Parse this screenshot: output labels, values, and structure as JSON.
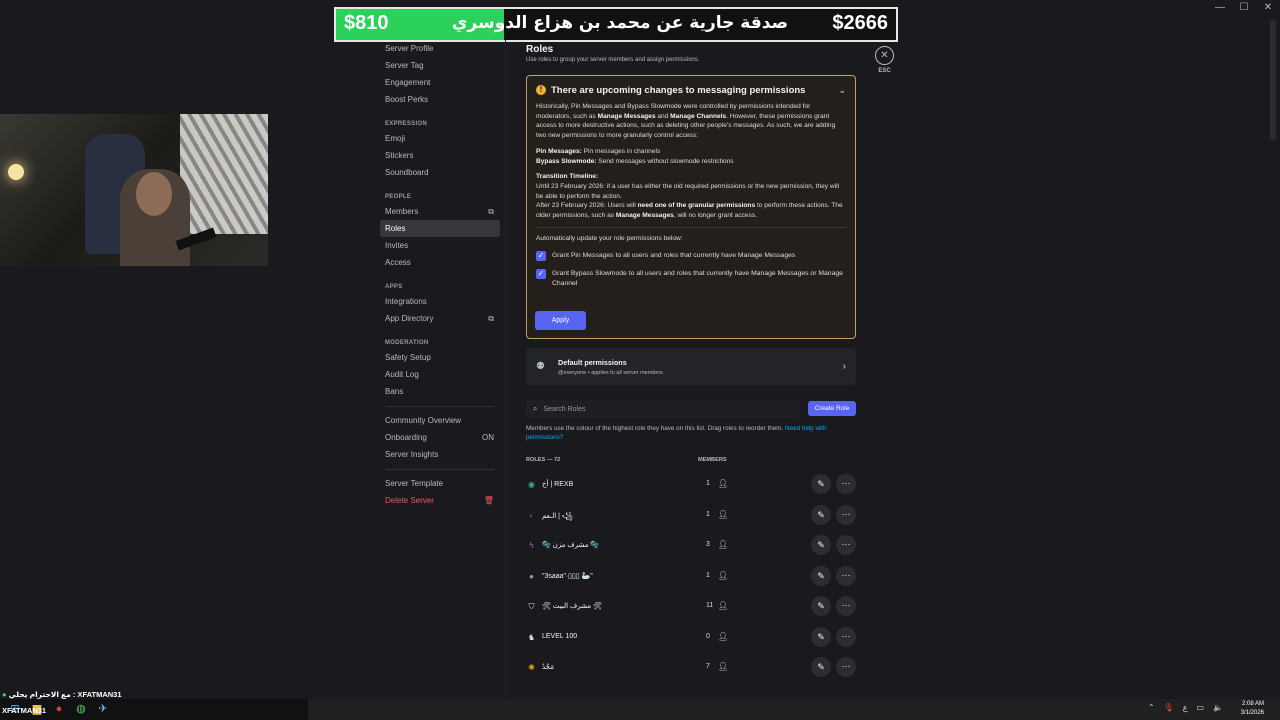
{
  "banner": {
    "left_amount": "$810",
    "message": "صدقة جارية عن محمد بن هزاع الدوسري رحمه الله",
    "right_amount": "$2666",
    "progress": 0.3
  },
  "window_controls": [
    "—",
    "☐",
    "✕"
  ],
  "sidebar": {
    "top_items": [
      {
        "label": "Server Profile"
      },
      {
        "label": "Server Tag"
      },
      {
        "label": "Engagement"
      },
      {
        "label": "Boost Perks"
      }
    ],
    "expression": {
      "title": "EXPRESSION",
      "items": [
        {
          "label": "Emoji"
        },
        {
          "label": "Stickers"
        },
        {
          "label": "Soundboard"
        }
      ]
    },
    "people": {
      "title": "PEOPLE",
      "items": [
        {
          "label": "Members",
          "extra": "⧉"
        },
        {
          "label": "Roles",
          "active": true
        },
        {
          "label": "Invites"
        },
        {
          "label": "Access"
        }
      ]
    },
    "apps": {
      "title": "APPS",
      "items": [
        {
          "label": "Integrations"
        },
        {
          "label": "App Directory",
          "extra": "⧉"
        }
      ]
    },
    "moderation": {
      "title": "MODERATION",
      "items": [
        {
          "label": "Safety Setup"
        },
        {
          "label": "Audit Log"
        },
        {
          "label": "Bans"
        }
      ]
    },
    "community": [
      {
        "label": "Community Overview"
      },
      {
        "label": "Onboarding",
        "extra": "ON"
      },
      {
        "label": "Server Insights"
      }
    ],
    "bottom": [
      {
        "label": "Server Template"
      },
      {
        "label": "Delete Server",
        "danger": true,
        "extra": "🗑"
      }
    ]
  },
  "main": {
    "title": "Roles",
    "subtitle": "Use roles to group your server members and assign permissions.",
    "notice": {
      "title": "There are upcoming changes to messaging permissions",
      "p1_a": "Historically, Pin Messages and Bypass Slowmode were controlled by permissions intended for moderators, such as ",
      "p1_b": "Manage Messages",
      "p1_c": " and ",
      "p1_d": "Manage Channels",
      "p1_e": ". However, these permissions grant access to more destructive actions, such as deleting other people's messages. As such, we are adding two new permissions to more granularly control access:",
      "pin_label": "Pin Messages:",
      "pin_text": " Pin messages in channels",
      "bypass_label": "Bypass Slowmode:",
      "bypass_text": " Send messages without slowmode restrictions",
      "timeline_label": "Transition Timeline:",
      "timeline_1": "Until 23 February 2026: if a user has either the old required permissions or the new permission, they will be able to perform the action.",
      "timeline_2a": "After 23 February 2026: Users will ",
      "timeline_2b": "need one of the granular permissions",
      "timeline_2c": " to perform these actions. The older permissions, such as ",
      "timeline_2d": "Manage Messages",
      "timeline_2e": ", will no longer grant access.",
      "auto_update": "Automatically update your role permissions below:",
      "check_1": "Grant Pin Messages to all users and roles that currently have Manage Messages",
      "check_2": "Grant Bypass Slowmode to all users and roles that currently have Manage Messages or Manage Channel",
      "apply": "Apply"
    },
    "default_permissions": {
      "title": "Default permissions",
      "subtitle": "@everyone • applies to all server members"
    },
    "search_placeholder": "Search Roles",
    "create_role": "Create Role",
    "hint": "Members use the colour of the highest role they have on this list. Drag roles to reorder them.",
    "hint_link": "Need help with permissions?",
    "col_roles": "ROLES — 72",
    "col_members": "MEMBERS",
    "roles": [
      {
        "icon": "◉",
        "color": "#3aa9a0",
        "name": "أخ | REXB",
        "members": "1"
      },
      {
        "icon": "◐",
        "color": "#555555",
        "name": "الـعم | ꧁",
        "members": "1"
      },
      {
        "icon": "ϟ",
        "color": "#c050d8",
        "name": "🫧 مشرف مزن 🫧",
        "members": "3"
      },
      {
        "icon": "●",
        "color": "#9a9a9a",
        "name": "\"3saaa\"∙▯▯▯ 🦢\"",
        "members": "1"
      },
      {
        "icon": "⛉",
        "color": "#dbdee1",
        "name": "🛠  مشرف البيت  🛠",
        "members": "11"
      },
      {
        "icon": "♞",
        "color": "#dbdee1",
        "name": "LEVEL 100",
        "members": "0"
      },
      {
        "icon": "✺",
        "color": "#e0a020",
        "name": "مَجْدٌ",
        "members": "7"
      }
    ]
  },
  "close": {
    "icon": "✕",
    "label": "ESC"
  },
  "chat": {
    "line1": "مع الاحترام يحلي : XFATMAN31",
    "line2": "XFATMAN31"
  },
  "taskbar": {
    "time": "2:08 AM",
    "date": "3/1/2026",
    "lang": "ع"
  }
}
